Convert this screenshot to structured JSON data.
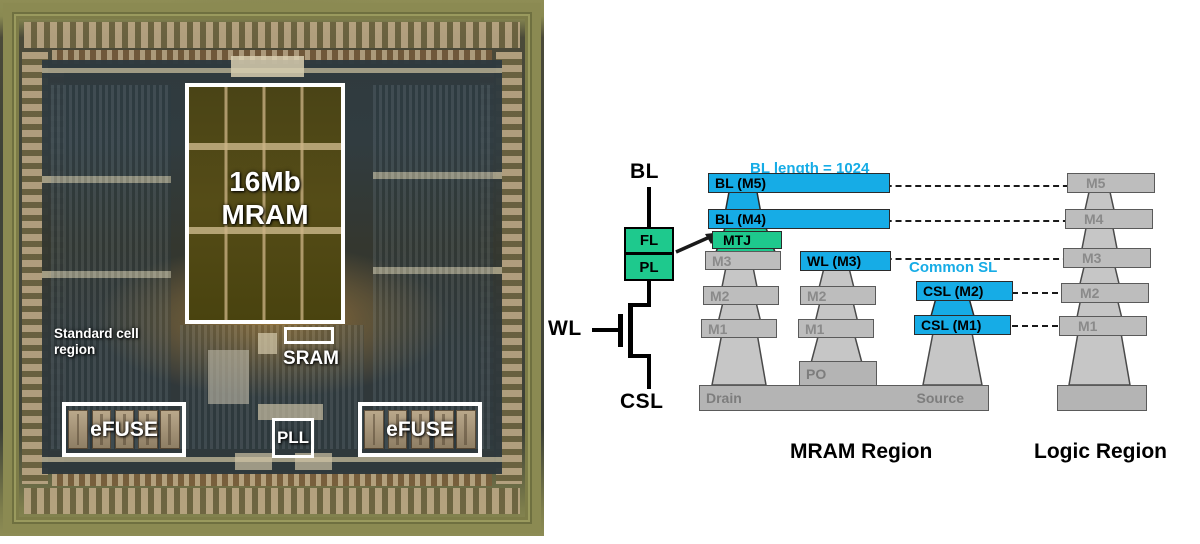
{
  "die_photo": {
    "name": "chip-die-micrograph",
    "annotations": {
      "mram_block": "16Mb\nMRAM",
      "standard_cell": "Standard cell\nregion",
      "sram": "SRAM",
      "pll": "PLL",
      "efuse_left": "eFUSE",
      "efuse_right": "eFUSE"
    }
  },
  "diagram": {
    "schematic": {
      "top_terminal": "BL",
      "bottom_terminal": "CSL",
      "gate_terminal": "WL",
      "mtj_free_layer": "FL",
      "mtj_pinned_layer": "PL"
    },
    "annotations": {
      "bl_length": "BL length = 1024",
      "common_sl": "Common SL"
    },
    "mram_region_label": "MRAM Region",
    "logic_region_label": "Logic Region",
    "mram_stack": {
      "bitline_column": [
        {
          "label": "BL (M5)",
          "kind": "blue"
        },
        {
          "label": "BL (M4)",
          "kind": "blue"
        },
        {
          "label": "MTJ",
          "kind": "mtj"
        },
        {
          "label": "M3",
          "kind": "grey"
        },
        {
          "label": "M2",
          "kind": "grey"
        },
        {
          "label": "M1",
          "kind": "grey"
        }
      ],
      "wordline_column": [
        {
          "label": "WL (M3)",
          "kind": "blue"
        },
        {
          "label": "M2",
          "kind": "grey"
        },
        {
          "label": "M1",
          "kind": "grey"
        },
        {
          "label": "PO",
          "kind": "sub"
        }
      ],
      "sourceline_column": [
        {
          "label": "CSL (M2)",
          "kind": "blue"
        },
        {
          "label": "CSL (M1)",
          "kind": "blue"
        }
      ],
      "substrate": {
        "left": "Drain",
        "right": "Source"
      }
    },
    "logic_stack": [
      {
        "label": "M5"
      },
      {
        "label": "M4"
      },
      {
        "label": "M3"
      },
      {
        "label": "M2"
      },
      {
        "label": "M1"
      },
      {
        "label": ""
      }
    ]
  },
  "colors": {
    "metal_blue": "#16ace6",
    "mtj_green": "#1ec98d",
    "metal_grey": "#bdbdbd",
    "outline": "#555555",
    "text_black": "#000000",
    "callout_white": "#ffffff"
  }
}
